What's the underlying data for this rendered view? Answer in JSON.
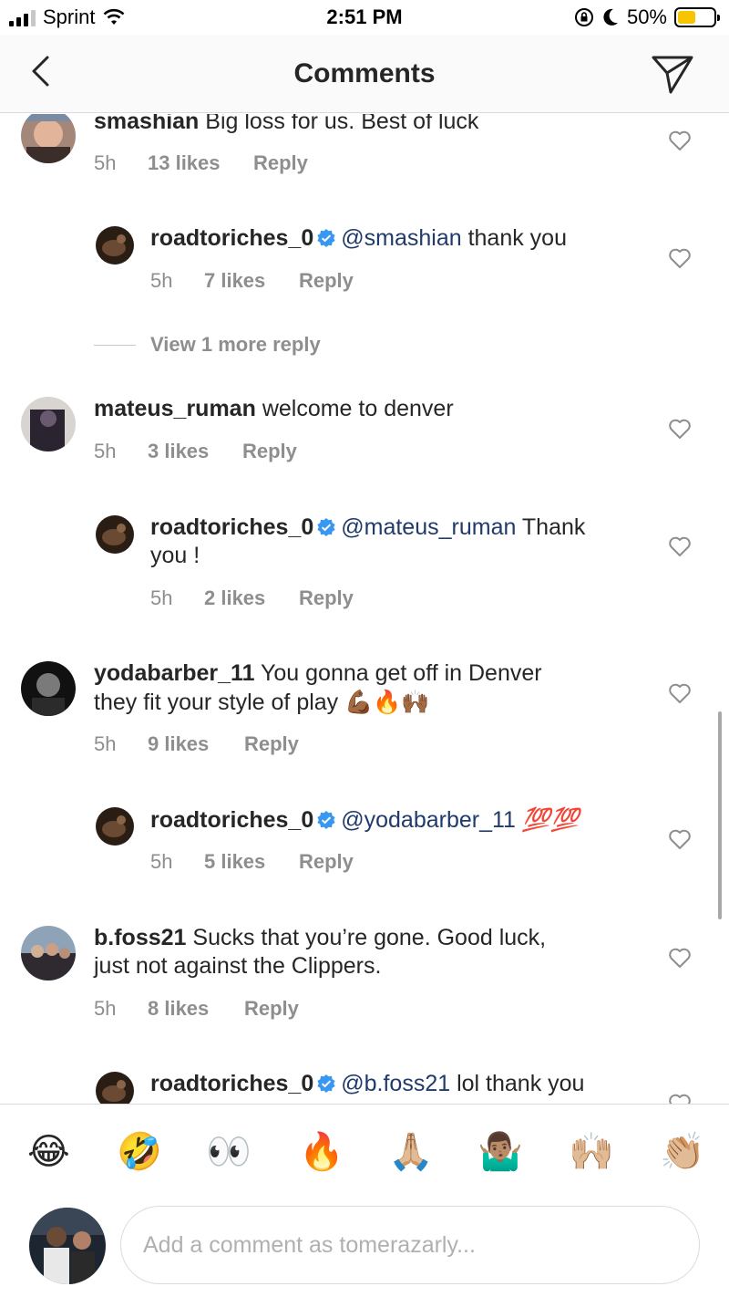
{
  "status": {
    "carrier": "Sprint",
    "time": "2:51 PM",
    "battery": "50%",
    "battery_level": 0.5
  },
  "header": {
    "title": "Comments",
    "back_icon": "chevron-left-icon",
    "send_icon": "direct-send-icon"
  },
  "comments": [
    {
      "user": "smashian",
      "text": "Big loss for us. Best of luck",
      "time": "5h",
      "likes": "13 likes",
      "reply": "Reply"
    },
    {
      "user": "roadtoriches_0",
      "mention": "@smashian",
      "text": "thank you",
      "time": "5h",
      "likes": "7 likes",
      "reply": "Reply"
    },
    {
      "user": "mateus_ruman",
      "text": "welcome to denver",
      "time": "5h",
      "likes": "3 likes",
      "reply": "Reply"
    },
    {
      "user": "roadtoriches_0",
      "mention": "@mateus_ruman",
      "text": "Thank",
      "text2": "you !",
      "time": "5h",
      "likes": "2 likes",
      "reply": "Reply"
    },
    {
      "user": "yodabarber_11",
      "text": "You gonna get off in Denver",
      "text2": "they fit your style of play",
      "emoji": "💪🏾🔥🙌🏾",
      "time": "5h",
      "likes": "9 likes",
      "reply": "Reply"
    },
    {
      "user": "roadtoriches_0",
      "mention": "@yodabarber_11",
      "emoji": "💯💯",
      "time": "5h",
      "likes": "5 likes",
      "reply": "Reply"
    },
    {
      "user": "b.foss21",
      "text": "Sucks that you’re gone. Good luck,",
      "text2": "just not against the Clippers.",
      "time": "5h",
      "likes": "8 likes",
      "reply": "Reply"
    },
    {
      "user": "roadtoriches_0",
      "mention": "@b.foss21",
      "text": "lol thank you"
    }
  ],
  "view_more": "View 1 more reply",
  "emoji_bar": [
    "😂",
    "🤣",
    "👀",
    "🔥",
    "🙏🏼",
    "🤷🏽‍♂️",
    "🙌🏼",
    "👏🏼"
  ],
  "composer": {
    "placeholder": "Add a comment as tomerazarly..."
  }
}
